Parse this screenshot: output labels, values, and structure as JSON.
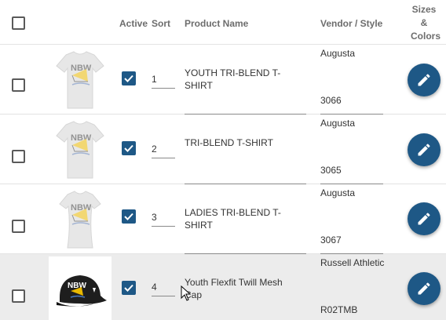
{
  "header": {
    "active": "Active",
    "sort": "Sort",
    "product_name": "Product Name",
    "vendor_style": "Vendor / Style",
    "sizes_line1": "Sizes",
    "sizes_line2": "&",
    "sizes_line3": "Colors"
  },
  "rows": [
    {
      "sort": "1",
      "name_line1": "YOUTH TRI-BLEND T-",
      "name_line2": "SHIRT",
      "vendor": "Augusta",
      "style": "3066",
      "active": true,
      "image": "white-tshirt-nbw"
    },
    {
      "sort": "2",
      "name_line1": "TRI-BLEND T-SHIRT",
      "name_line2": "",
      "vendor": "Augusta",
      "style": "3065",
      "active": true,
      "image": "white-tshirt-nbw"
    },
    {
      "sort": "3",
      "name_line1": "LADIES TRI-BLEND T-",
      "name_line2": "SHIRT",
      "vendor": "Augusta",
      "style": "3067",
      "active": true,
      "image": "white-tshirt-nbw"
    },
    {
      "sort": "4",
      "name_line1": "Youth Flexfit Twill Mesh",
      "name_line2": "Cap",
      "vendor": "Russell Athletic",
      "style": "R02TMB",
      "active": true,
      "image": "black-cap-nbw"
    }
  ],
  "icons": {
    "edit": "pencil-icon",
    "checkbox": "checkbox-icon"
  },
  "colors": {
    "accent": "#1e5886",
    "row_highlight": "#ececec"
  }
}
